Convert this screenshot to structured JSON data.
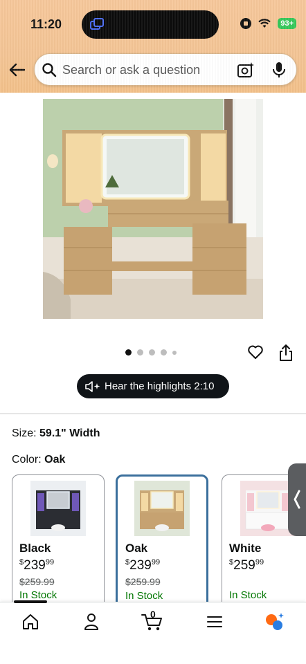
{
  "status_bar": {
    "time": "11:20",
    "battery": "93+"
  },
  "search": {
    "placeholder": "Search or ask a question"
  },
  "gallery": {
    "dot_count": 5,
    "active_index": 0
  },
  "highlights": {
    "label": "Hear the highlights 2:10"
  },
  "options": {
    "size_label": "Size:",
    "size_value": "59.1\" Width",
    "color_label": "Color:",
    "color_value": "Oak"
  },
  "swatches": [
    {
      "name": "Black",
      "currency": "$",
      "price_whole": "239",
      "price_cents": "99",
      "list_price": "$259.99",
      "stock": "In Stock"
    },
    {
      "name": "Oak",
      "currency": "$",
      "price_whole": "239",
      "price_cents": "99",
      "list_price": "$259.99",
      "stock": "In Stock"
    },
    {
      "name": "White",
      "currency": "$",
      "price_whole": "259",
      "price_cents": "99",
      "list_price": "",
      "stock": "In Stock"
    }
  ],
  "nav": {
    "cart_count": "0"
  },
  "colors": {
    "header": "#f3c494",
    "selected_border": "#3a6f9c",
    "in_stock": "#007600",
    "ai_accent": "#ff6a13"
  }
}
